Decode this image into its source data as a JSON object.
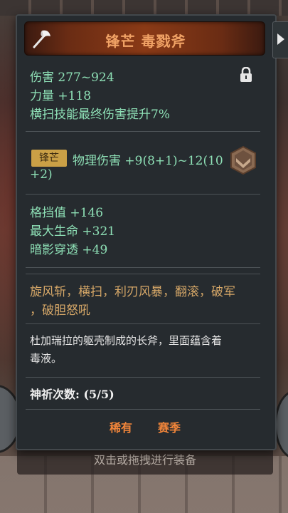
{
  "item": {
    "name": "锋芒 毒戮斧",
    "base_stats": [
      "伤害  277~924",
      "力量 +118",
      "横扫技能最终伤害提升7%"
    ],
    "affix_tag": "锋芒",
    "affix_line1": "物理伤害 +9(8+1)~12(10",
    "affix_line2": "+2)",
    "extra_stats": [
      "格挡值 +146",
      "最大生命 +321",
      "暗影穿透 +49"
    ],
    "skills_line1": "旋风斩，横扫，利刃风暴，翻滚，破军",
    "skills_line2": "，破胆怒吼",
    "description_line1": "杜加瑞拉的躯壳制成的长斧，里面蕴含着",
    "description_line2": "毒液。",
    "prayer_count": "神祈次数: (5/5)",
    "rarity": "稀有",
    "season": "赛季"
  },
  "bottom_hint": "双击或拖拽进行装备",
  "colors": {
    "stat_green": "#8ee0b6",
    "title_orange": "#f0a265",
    "skill_gold": "#d7a868",
    "tag_orange": "#f1853a"
  }
}
